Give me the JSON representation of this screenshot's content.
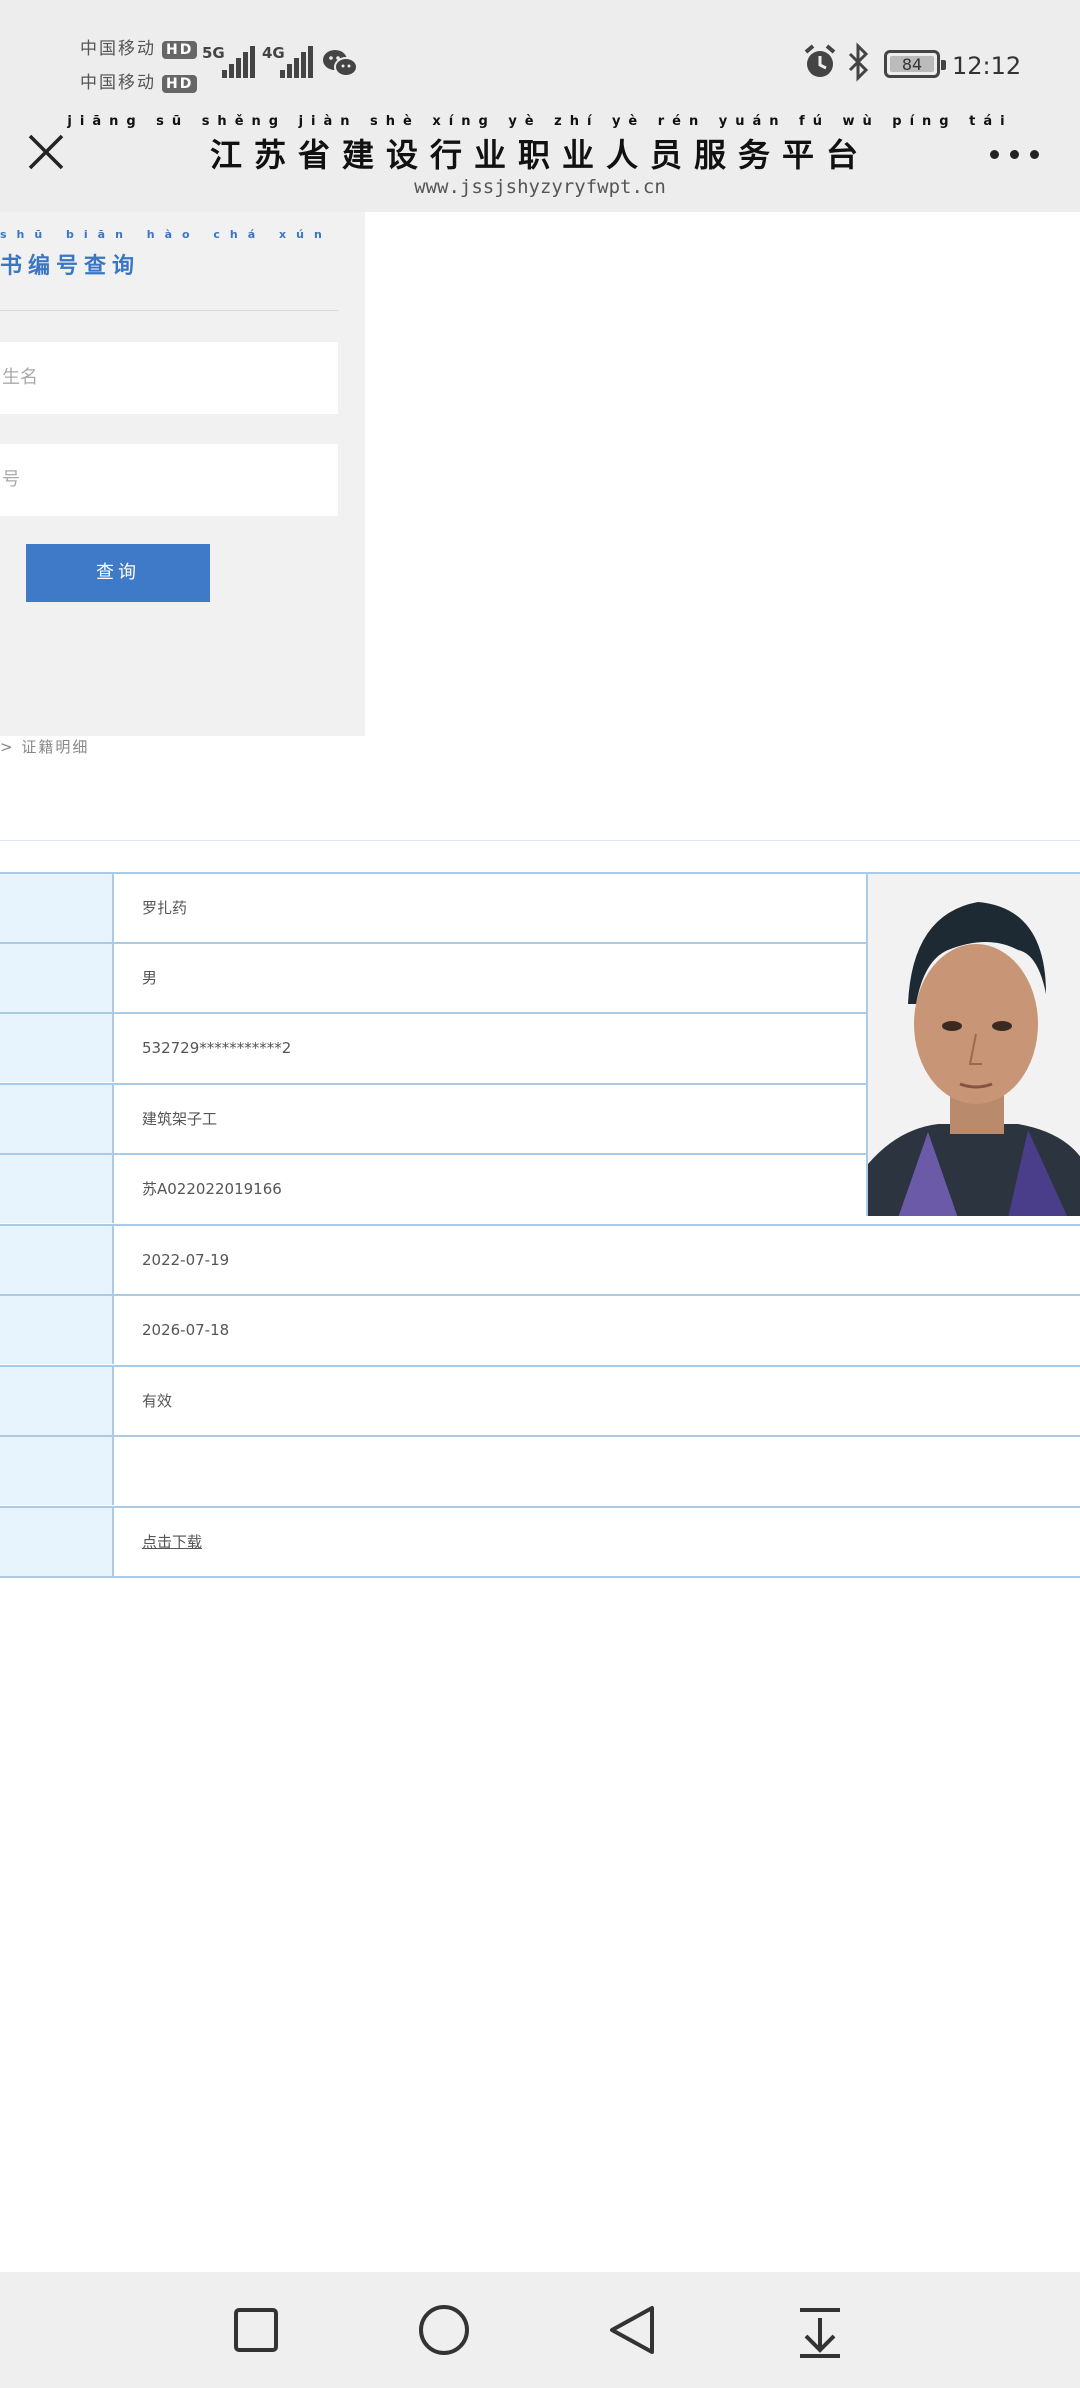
{
  "status_bar": {
    "carrier_1": "中国移动",
    "carrier_2": "中国移动",
    "hd_badge": "HD",
    "net_1": "5G",
    "net_2": "4G",
    "battery_level": "84",
    "time": "12:12"
  },
  "title_bar": {
    "site_pinyin": "jiāng sū shěng jiàn shè xíng yè zhí yè rén yuán fú wù píng tái",
    "site_title": "江苏省建设行业职业人员服务平台",
    "site_url": "www.jssjshyzyryfwpt.cn"
  },
  "query_panel": {
    "title_pinyin": "shū biān hào chá xún",
    "title": "书编号查询",
    "field_name_placeholder": "生名",
    "field_code_placeholder": "号",
    "query_button": "查询",
    "detail_link": "> 证籍明细"
  },
  "result": {
    "rows": [
      {
        "value": "罗扎药"
      },
      {
        "value": "男"
      },
      {
        "value": "532729***********2"
      },
      {
        "value": "建筑架子工"
      },
      {
        "value": "苏A022022019166"
      },
      {
        "value": "2022-07-19"
      },
      {
        "value": "2026-07-18"
      },
      {
        "value": "有效"
      },
      {
        "value": ""
      },
      {
        "value": "点击下载"
      }
    ]
  },
  "colors": {
    "accent": "#3f7ac9",
    "table_border": "#a9cbe6",
    "label_bg": "#e8f4fd"
  },
  "icons": {
    "close": "close-icon",
    "more": "more-icon",
    "alarm": "alarm-icon",
    "bluetooth": "bluetooth-icon",
    "wechat": "wechat-icon",
    "nav_recent": "square-icon",
    "nav_home": "circle-icon",
    "nav_back": "triangle-back-icon",
    "nav_notifications": "pull-down-icon"
  }
}
